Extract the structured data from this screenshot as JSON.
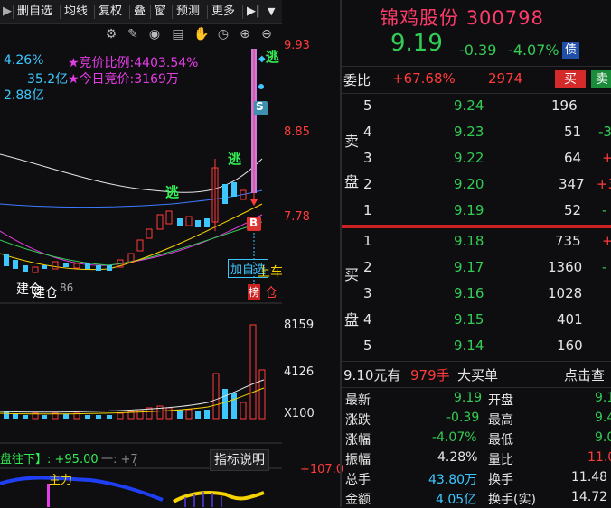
{
  "toolbar": {
    "remove": "删自选",
    "ma": "均线",
    "restore": "复权",
    "overlay": "叠",
    "window": "窗",
    "forecast": "预测",
    "more": "更多"
  },
  "chart": {
    "price_labels": [
      "9.93",
      "8.85",
      "7.78"
    ],
    "vol_labels": [
      "8159",
      "4126",
      "X100"
    ],
    "macd_top": "+107.0",
    "indicator_button": "指标说明",
    "overlay_lines": [
      {
        "text": "4.26%",
        "color": "#3ec7ff"
      },
      {
        "text": "35.2亿",
        "color": "#3ec7ff"
      },
      {
        "text": "2.88亿",
        "color": "#3ec7ff"
      }
    ],
    "auction_ratio": "★竞价比例:4403.54%",
    "auction_price": "★今日竞价:3169万",
    "signals": {
      "escape1": "逃",
      "escape2": "逃",
      "escape3": "逃",
      "s": "S",
      "b": "B",
      "add_watch": "加自选",
      "board": "上车",
      "list": "榜",
      "warehouse": "仓",
      "build1": "建仓",
      "build2": "建仓",
      "num": "86"
    },
    "macd_label": "盘往下】: +95.00",
    "macd_label2": "一: +7̹",
    "main_force": "主力"
  },
  "stock": {
    "name": "锦鸡股份",
    "code": "300798",
    "price": "9.19",
    "change": "-0.39",
    "change_pct": "-4.07%",
    "bond_tag": "债"
  },
  "order_ratio": {
    "label": "委比",
    "pct": "+67.68%",
    "diff": "2974",
    "buy": "买",
    "sell": "卖"
  },
  "ask_side_label": [
    "卖",
    "盘"
  ],
  "bid_side_label": [
    "买",
    "盘"
  ],
  "asks": [
    {
      "level": "5",
      "price": "9.24",
      "vol": "196",
      "extra": ""
    },
    {
      "level": "4",
      "price": "9.23",
      "vol": "51",
      "extra": "-3"
    },
    {
      "level": "3",
      "price": "9.22",
      "vol": "64",
      "extra": "+"
    },
    {
      "level": "2",
      "price": "9.20",
      "vol": "347",
      "extra": "+3"
    },
    {
      "level": "1",
      "price": "9.19",
      "vol": "52",
      "extra": "-"
    }
  ],
  "bids": [
    {
      "level": "1",
      "price": "9.18",
      "vol": "735",
      "extra": "+"
    },
    {
      "level": "2",
      "price": "9.17",
      "vol": "1360",
      "extra": "-"
    },
    {
      "level": "3",
      "price": "9.16",
      "vol": "1028",
      "extra": ""
    },
    {
      "level": "4",
      "price": "9.15",
      "vol": "401",
      "extra": ""
    },
    {
      "level": "5",
      "price": "9.14",
      "vol": "160",
      "extra": ""
    }
  ],
  "big_order": {
    "prefix": "9.10元有",
    "qty": "979手",
    "suffix": "大买单",
    "link": "点击查"
  },
  "stats": [
    {
      "l1": "最新",
      "v1": "9.19",
      "c1": "#33cc55",
      "l2": "开盘",
      "v2": "9.1",
      "c2": "#33cc55"
    },
    {
      "l1": "涨跌",
      "v1": "-0.39",
      "c1": "#33cc55",
      "l2": "最高",
      "v2": "9.4",
      "c2": "#33cc55"
    },
    {
      "l1": "涨幅",
      "v1": "-4.07%",
      "c1": "#33cc55",
      "l2": "最低",
      "v2": "9.0",
      "c2": "#33cc55"
    },
    {
      "l1": "振幅",
      "v1": "4.28%",
      "c1": "#e6e6e6",
      "l2": "量比",
      "v2": "11.0",
      "c2": "#ff3b3b"
    },
    {
      "l1": "总手",
      "v1": "43.80万",
      "c1": "#3ec7ff",
      "l2": "换手",
      "v2": "11.48",
      "c2": "#e6e6e6"
    },
    {
      "l1": "金额",
      "v1": "4.05亿",
      "c1": "#3ec7ff",
      "l2": "换手(实)",
      "v2": "14.72",
      "c2": "#e6e6e6"
    }
  ]
}
